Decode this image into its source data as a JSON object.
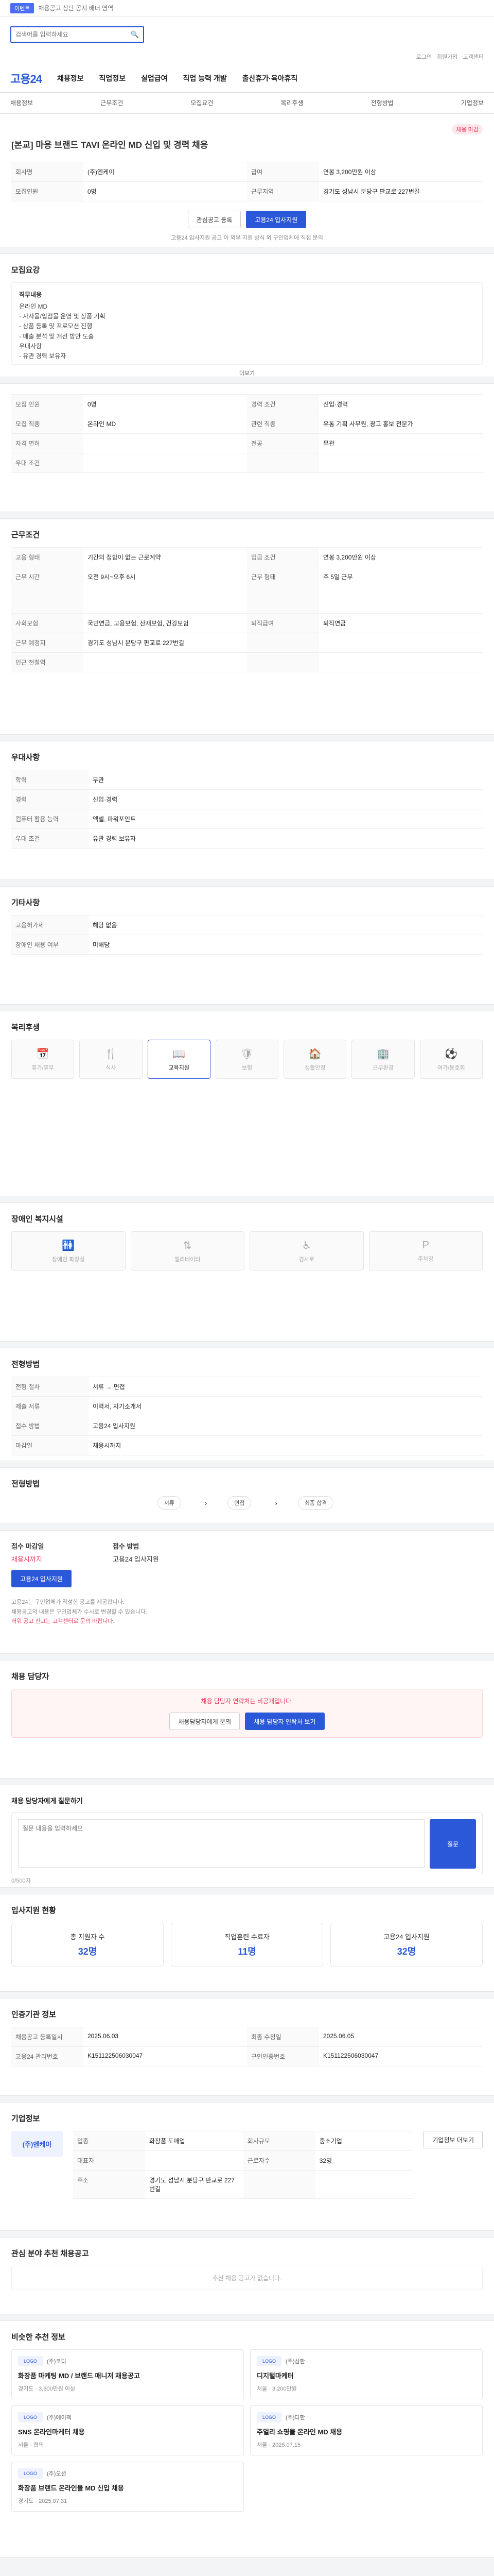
{
  "topbar": {
    "badge": "이벤트",
    "text": "채용공고 상단 공지 배너 영역"
  },
  "search": {
    "placeholder": "검색어를 입력하세요"
  },
  "toplinks": [
    "로그인",
    "회원가입",
    "고객센터"
  ],
  "gnb": {
    "logo": "고용24",
    "items": [
      "채용정보",
      "직업정보",
      "실업급여",
      "직업 능력 개발",
      "출산휴가·육아휴직"
    ]
  },
  "subnav": [
    "채용정보",
    "근무조건",
    "모집요건",
    "복리후생",
    "전형방법",
    "기업정보"
  ],
  "header": {
    "badge": "채용 마감",
    "title": "[본교] 마용 브랜드 TAVI 온라인 MD 신입 및 경력 채용",
    "labels": {
      "company": "회사명",
      "person": "모집인원",
      "pay": "급여",
      "period": "근무기간",
      "place": "근무지역"
    },
    "values": {
      "company": "(주)엔케이",
      "person": "0명",
      "pay": "연봉 3,200만원 이상",
      "period": "기간의 정함이 없는 근로계약",
      "place": "경기도 성남시 분당구 판교로 227번길"
    },
    "btns": {
      "scrap": "관심공고 등록",
      "apply": "고용24 입사지원"
    },
    "note": "고용24 입사지원 공고 이 외부 지원 방식 외 구인업체에 직접 문의"
  },
  "summary": {
    "title": "모집요강",
    "job": "직무내용",
    "desc": "온라인 MD\n- 자사몰/입점몰 운영 및 상품 기획\n- 상품 등록 및 프로모션 진행\n- 매출 분석 및 개선 방안 도출\n우대사항\n- 유관 경력 보유자",
    "more": "더보기"
  },
  "cond": {
    "rows": [
      [
        "모집 인원",
        "0명",
        "경력 조건",
        "신입·경력"
      ],
      [
        "모집 직종",
        "온라인 MD",
        "관련 직종",
        "유통 기획 사무원, 광고 홍보 전문가"
      ],
      [
        "자격 면허",
        "",
        "전공",
        "무관"
      ],
      [
        "우대 조건",
        "",
        null,
        null
      ]
    ]
  },
  "work": {
    "title": "근무조건",
    "rows": [
      [
        "고용 형태",
        "기간의 정함이 없는 근로계약",
        "임금 조건",
        "연봉 3,200만원 이상"
      ],
      [
        "근무 시간",
        "오전 9시~오후 6시",
        "근무 형태",
        "주 5일 근무"
      ],
      [
        "사회보험",
        "국민연금, 고용보험, 산재보험, 건강보험",
        "퇴직급여",
        "퇴직연금"
      ],
      [
        "근무 예정지",
        "경기도 성남시 분당구 판교로 227번길",
        "",
        ""
      ],
      [
        "인근 전철역",
        "",
        null,
        null
      ]
    ]
  },
  "req": {
    "title": "우대사항",
    "rows": [
      [
        "학력",
        "무관"
      ],
      [
        "경력",
        "신입·경력"
      ],
      [
        "컴퓨터 활용 능력",
        "엑셀, 파워포인트"
      ],
      [
        "우대 조건",
        "유관 경력 보유자"
      ]
    ]
  },
  "etc": {
    "title": "기타사항",
    "rows": [
      [
        "고용허가제",
        "해당 없음"
      ],
      [
        "장애인 채용 여부",
        "미해당"
      ]
    ]
  },
  "welfare": {
    "title": "복리후생",
    "tiles": [
      "휴가/휴무",
      "식사",
      "교육지원",
      "보험",
      "생활안정",
      "근무환경",
      "여가/동호회"
    ]
  },
  "benefits": {
    "title": "장애인 복지시설",
    "tiles": [
      "장애인 화장실",
      "엘리베이터",
      "경사로",
      "주차장"
    ]
  },
  "process": {
    "title": "전형방법",
    "rows": [
      [
        "전형 절차",
        "서류 → 면접"
      ],
      [
        "제출 서류",
        "이력서, 자기소개서"
      ],
      [
        "접수 방법",
        "고용24 입사지원"
      ],
      [
        "마감일",
        "채용시까지"
      ]
    ]
  },
  "steps": {
    "title": "전형방법",
    "items": [
      "서류",
      "면접",
      "최종 합격"
    ]
  },
  "recruit": {
    "title": "접수 마감일",
    "deadline": "채용시까지",
    "status": "접수 방법",
    "method": "고용24 입사지원",
    "btn": "고용24 입사지원"
  },
  "notices": [
    "고용24는 구인업체가 작성한 공고를 제공합니다.",
    "채용공고의 내용은 구인업체가 수시로 변경할 수 있습니다.",
    "허위 공고 신고는 고객센터로 문의 바랍니다."
  ],
  "contact": {
    "title": "채용 담당자",
    "warn": "채용 담당자 연락처는 비공개입니다.",
    "btn1": "채용담당자에게 문의",
    "btn2": "채용 담당자 연락처 보기"
  },
  "ask": {
    "title": "채용 담당자에게 질문하기",
    "placeholder": "질문 내용을 입력하세요",
    "btn": "질문",
    "count": "0/500자"
  },
  "stats": {
    "title": "입사지원 현황",
    "items": [
      {
        "k": "총 지원자 수",
        "n": "32명"
      },
      {
        "k": "직업훈련 수료자",
        "n": "11명"
      },
      {
        "k": "고용24 입사지원",
        "n": "32명"
      }
    ]
  },
  "meta": {
    "title": "인증기관 정보",
    "rows": [
      [
        "채용공고 등록일시",
        "2025.06.03",
        "최종 수정일",
        "2025.06.05"
      ],
      [
        "고용24 관리번호",
        "K151122506030047",
        "구인인증번호",
        "K151122506030047"
      ]
    ]
  },
  "company": {
    "title": "기업정보",
    "name": "(주)엔케이",
    "rows": [
      [
        "업종",
        "화장품 도매업",
        "회사규모",
        "중소기업"
      ],
      [
        "대표자",
        "",
        "근로자수",
        "32명"
      ],
      [
        "주소",
        "경기도 성남시 분당구 판교로 227번길",
        "",
        ""
      ]
    ],
    "btn": "기업정보 더보기"
  },
  "similar": {
    "title": "관심 분야 추천 채용공고",
    "empty": "추천 채용 공고가 없습니다."
  },
  "rec": {
    "title": "비슷한 추천 정보",
    "items": [
      {
        "co": "(주)코디",
        "ti": "화장품 마케팅 MD / 브랜드 매니저 채용공고",
        "mt": "경기도 · 3,600만원 이상"
      },
      {
        "co": "(주)삼한",
        "ti": "디지털마케터",
        "mt": "서울 · 3,200만원"
      },
      {
        "co": "(주)에이팩",
        "ti": "SNS 온라인마케터 채용",
        "mt": "서울 · 협의"
      },
      {
        "co": "(주)다한",
        "ti": "주얼리 쇼핑몰 온라인 MD 채용",
        "mt": "서울 · 2025.07.15"
      },
      {
        "co": "(주)오션",
        "ti": "화장품 브랜드 온라인몰 MD 신입 채용",
        "mt": "경기도 · 2025.07.31"
      }
    ]
  }
}
